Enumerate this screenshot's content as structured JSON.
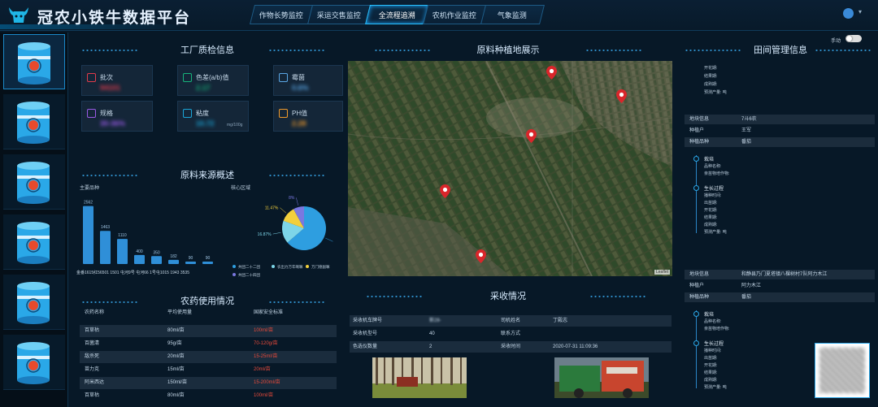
{
  "header": {
    "title": "冠农小铁牛数据平台",
    "tabs": [
      {
        "label": "作物长势监控"
      },
      {
        "label": "采运交售监控"
      },
      {
        "label": "全流程追溯"
      },
      {
        "label": "农机作业监控"
      },
      {
        "label": "气象监测"
      }
    ],
    "active_tab": 2
  },
  "sidebar": {
    "items": 6,
    "active": 0
  },
  "quality": {
    "title": "工厂质检信息",
    "cards": [
      {
        "label": "批次",
        "value": "94101",
        "unit": "",
        "icon": "document-icon",
        "color": "#e23b4b"
      },
      {
        "label": "色差(a/b)值",
        "value": "2.17",
        "unit": "",
        "icon": "paint-bucket-icon",
        "color": "#17b37a"
      },
      {
        "label": "霉菌",
        "value": "0.6%",
        "unit": "",
        "icon": "grid-icon",
        "color": "#5aa7e6"
      },
      {
        "label": "规格",
        "value": "30-36%",
        "unit": "",
        "icon": "ruler-icon",
        "color": "#9a5ae6"
      },
      {
        "label": "粘度",
        "value": "10.72",
        "unit": "mg/100g",
        "icon": "cycle-icon",
        "color": "#1aa6d8"
      },
      {
        "label": "PH值",
        "value": "2.28",
        "unit": "",
        "icon": "flask-icon",
        "color": "#f29b2a"
      }
    ]
  },
  "source": {
    "title": "原料来源概述",
    "bar_label": "主要品种",
    "pie_label": "核心区域",
    "legend": [
      "共团二十二团",
      "农出力万年啊嘛",
      "万门德副嘛",
      "共团二十四团"
    ]
  },
  "chart_data": [
    {
      "type": "bar",
      "categories": [
        "金番1615",
        "红56501",
        "1501",
        "屯河9号",
        "屯河66",
        "1015",
        "1943",
        "3535"
      ],
      "values": [
        2562,
        1463,
        1110,
        400,
        350,
        182,
        90,
        90
      ],
      "tick_label_text": "金番1615红56501 1501 屯河9号 屯河66 1号屯1015 1943   3535",
      "ylim": [
        0,
        2800
      ],
      "color": "#2f8fd8"
    },
    {
      "type": "pie",
      "labels": [
        "共团二十二团",
        "农出力万年啊嘛",
        "万门德副嘛",
        "共团二十四团"
      ],
      "values": [
        63.66,
        16.87,
        11.47,
        8
      ],
      "value_labels": [
        "63.66%",
        "16.87%",
        "11.47%",
        "8%"
      ],
      "colors": [
        "#2e9ee0",
        "#7dd5e8",
        "#f2cf3c",
        "#7a78e0"
      ]
    }
  ],
  "pesticide": {
    "title": "农药使用情况",
    "headers": [
      "农药名称",
      "平均使用量",
      "国家安全标准"
    ],
    "rows": [
      [
        "百草枯",
        "80ml/亩",
        "100ml/亩"
      ],
      [
        "百菌清",
        "95g/亩",
        "70-120g/亩"
      ],
      [
        "敌杀死",
        "20ml/亩",
        "15-25ml/亩"
      ],
      [
        "苗力克",
        "15ml/亩",
        "20ml/亩"
      ],
      [
        "阿米西达",
        "150ml/亩",
        "15-200ml/亩"
      ],
      [
        "百草枯",
        "80ml/亩",
        "100ml/亩"
      ]
    ]
  },
  "map": {
    "title": "原料种植地展示",
    "attribution": "Leaflet"
  },
  "harvest": {
    "title": "采收情况",
    "rows": [
      [
        "采收机车牌号",
        "新28-",
        "司机姓名",
        "丁殿志"
      ],
      [
        "采收机型号",
        "40",
        "联系方式",
        ""
      ],
      [
        "色选仪数量",
        "2",
        "采收时间",
        "2020-07-31 11:09:36"
      ]
    ]
  },
  "field": {
    "title": "田间管理信息",
    "toggle_label": "手动",
    "top_lines": [
      "开花期:",
      "结果期:",
      "成熟期:",
      "预测产量:   吨"
    ],
    "block1": {
      "rows": [
        [
          "地块信息",
          "7斗6农"
        ],
        [
          "种植户",
          "王军"
        ],
        [
          "种植品种",
          "番茄"
        ]
      ]
    },
    "block1_timeline": [
      {
        "heading": "栽培",
        "lines": [
          "品种名称:",
          "亲苗物培作物:"
        ]
      },
      {
        "heading": "生长过程",
        "lines": [
          "播种时间:",
          "出苗期:",
          "开花期:",
          "结果期:",
          "成熟期:",
          "预测产量:   吨"
        ]
      }
    ],
    "block2": {
      "rows": [
        [
          "地块信息",
          "和静县乃门夏塔镇八棵树村7队阿力木江"
        ],
        [
          "种植户",
          "阿力木江"
        ],
        [
          "种植品种",
          "番茄"
        ]
      ]
    },
    "block2_timeline": [
      {
        "heading": "栽培",
        "lines": [
          "品种名称:",
          "亲苗物培作物:"
        ]
      },
      {
        "heading": "生长过程",
        "lines": [
          "播种时间:",
          "出苗期:",
          "开花期:",
          "结果期:",
          "成熟期:",
          "预测产量:   吨"
        ]
      }
    ]
  }
}
